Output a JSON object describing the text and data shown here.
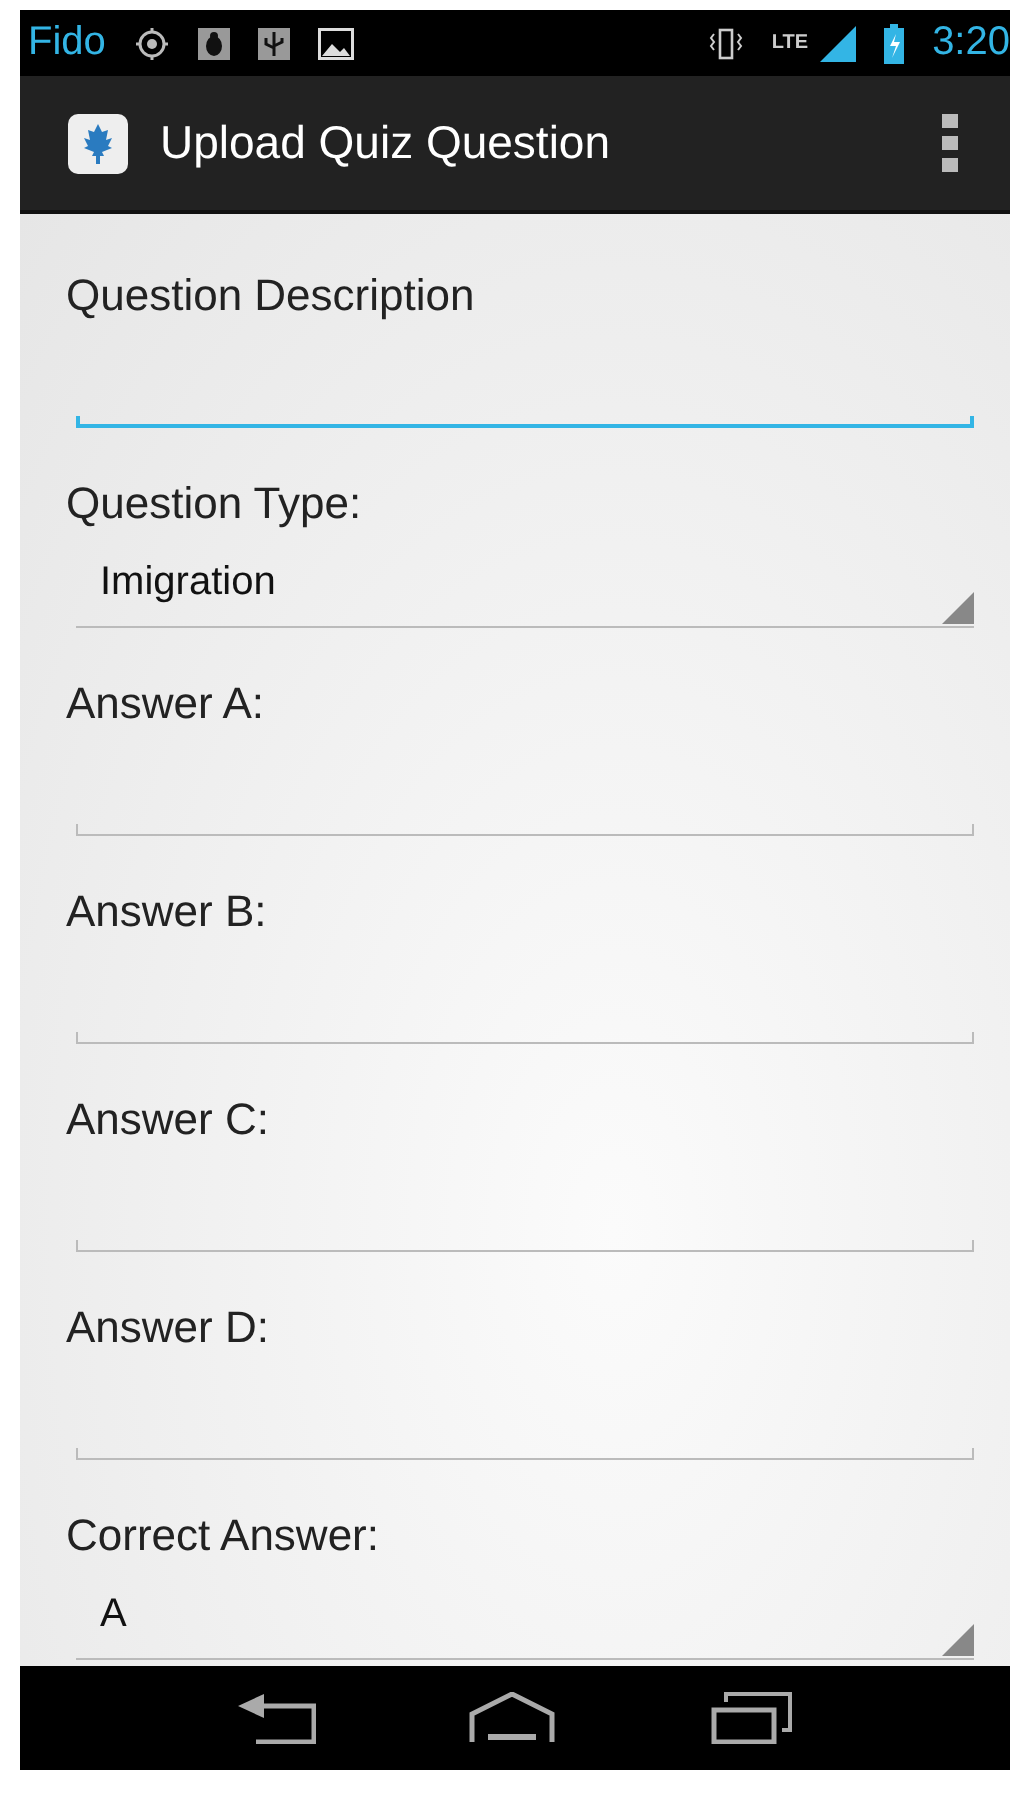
{
  "status_bar": {
    "carrier": "Fido",
    "time": "3:20",
    "network": "LTE"
  },
  "action_bar": {
    "title": "Upload Quiz Question"
  },
  "fields": [
    {
      "label": "Question Description",
      "kind": "input",
      "focused": true
    },
    {
      "label": "Question Type:",
      "kind": "spinner",
      "value": "Imigration"
    },
    {
      "label": "Answer A:",
      "kind": "input",
      "focused": false
    },
    {
      "label": "Answer B:",
      "kind": "input",
      "focused": false
    },
    {
      "label": "Answer C:",
      "kind": "input",
      "focused": false
    },
    {
      "label": "Answer D:",
      "kind": "input",
      "focused": false
    },
    {
      "label": "Correct Answer:",
      "kind": "spinner",
      "value": "A"
    }
  ]
}
